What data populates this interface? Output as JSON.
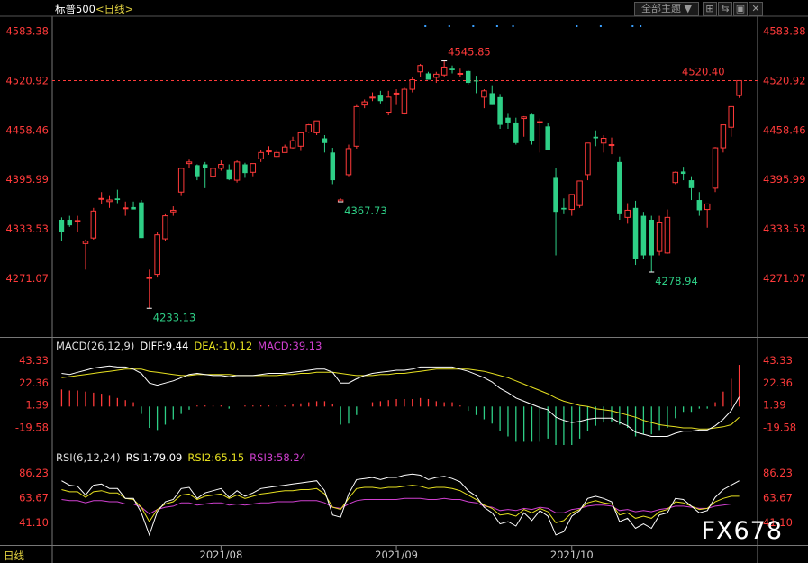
{
  "header": {
    "symbol": "标普500",
    "period_prefix": "<",
    "period": "日线",
    "period_suffix": ">",
    "theme_menu": "全部主题",
    "theme_arrow": "▼"
  },
  "toolbar": {
    "icons": [
      "crosshair-icon",
      "restore-icon",
      "dock-icon",
      "close-icon"
    ],
    "glyphs": [
      "⊞",
      "⇆",
      "▣",
      "✕"
    ]
  },
  "watermark": "FX678",
  "bottom_label": "日线",
  "colors": {
    "up": "#ff3a3a",
    "down": "#2ecf86",
    "axis_text": "#ff3a3a",
    "grid": "#333333",
    "last_line": "#ff3a3a",
    "diff": "#ffffff",
    "dea": "#e6e020",
    "macd": "#d040d0",
    "rsi1": "#ffffff",
    "rsi2": "#e6e020",
    "rsi3": "#d040d0",
    "annot_high": "#ff3a3a",
    "annot_low": "#2ecf86"
  },
  "chart_data": [
    {
      "type": "candlestick",
      "ylim": [
        4230,
        4600
      ],
      "yticks": [
        "4583.38",
        "4520.92",
        "4458.46",
        "4395.99",
        "4333.53",
        "4271.07"
      ],
      "last_price": 4520.92,
      "candles": [
        [
          4345,
          4348,
          4318,
          4330
        ],
        [
          4345,
          4350,
          4336,
          4338
        ],
        [
          4343,
          4350,
          4330,
          4344
        ],
        [
          4315,
          4320,
          4282,
          4318
        ],
        [
          4322,
          4360,
          4320,
          4356
        ],
        [
          4372,
          4380,
          4365,
          4372
        ],
        [
          4368,
          4375,
          4360,
          4370
        ],
        [
          4372,
          4383,
          4366,
          4370
        ],
        [
          4360,
          4368,
          4350,
          4360
        ],
        [
          4361,
          4368,
          4358,
          4358
        ],
        [
          4367,
          4370,
          4322,
          4322
        ],
        [
          4272,
          4282,
          4233.13,
          4272
        ],
        [
          4276,
          4330,
          4272,
          4326
        ],
        [
          4321,
          4352,
          4318,
          4350
        ],
        [
          4355,
          4362,
          4350,
          4357
        ],
        [
          4380,
          4410,
          4375,
          4410
        ],
        [
          4416,
          4421,
          4410,
          4418
        ],
        [
          4414,
          4415,
          4395,
          4400
        ],
        [
          4415,
          4418,
          4385,
          4410
        ],
        [
          4400,
          4410,
          4397,
          4410
        ],
        [
          4410,
          4420,
          4407,
          4415
        ],
        [
          4408,
          4415,
          4395,
          4396
        ],
        [
          4395,
          4420,
          4392,
          4418
        ],
        [
          4415,
          4417,
          4398,
          4404
        ],
        [
          4405,
          4415,
          4400,
          4416
        ],
        [
          4422,
          4433,
          4418,
          4430
        ],
        [
          4432,
          4438,
          4427,
          4432
        ],
        [
          4425,
          4433,
          4424,
          4430
        ],
        [
          4430,
          4440,
          4430,
          4437
        ],
        [
          4436,
          4450,
          4435,
          4445
        ],
        [
          4438,
          4455,
          4432,
          4455
        ],
        [
          4456,
          4466,
          4455,
          4465
        ],
        [
          4455,
          4470,
          4452,
          4470
        ],
        [
          4448,
          4452,
          4430,
          4442
        ],
        [
          4430,
          4436,
          4390,
          4395
        ],
        [
          4367.73,
          4372,
          4367.73,
          4370
        ],
        [
          4402,
          4440,
          4400,
          4435
        ],
        [
          4438,
          4490,
          4435,
          4488
        ],
        [
          4490,
          4497,
          4486,
          4494
        ],
        [
          4500,
          4506,
          4495,
          4500
        ],
        [
          4502,
          4508,
          4492,
          4495
        ],
        [
          4481,
          4508,
          4477,
          4500
        ],
        [
          4504,
          4510,
          4490,
          4505
        ],
        [
          4480,
          4512,
          4478,
          4510
        ],
        [
          4510,
          4525,
          4506,
          4522
        ],
        [
          4532,
          4542,
          4525,
          4540
        ],
        [
          4530,
          4532,
          4523,
          4522
        ],
        [
          4525,
          4532,
          4518,
          4529
        ],
        [
          4528,
          4545.85,
          4525,
          4538
        ],
        [
          4536,
          4540,
          4530,
          4534
        ],
        [
          4530,
          4536,
          4525,
          4530
        ],
        [
          4533,
          4534,
          4516,
          4518
        ],
        [
          4521,
          4527,
          4505,
          4520
        ],
        [
          4500,
          4510,
          4486,
          4508
        ],
        [
          4505,
          4515,
          4490,
          4490
        ],
        [
          4500,
          4504,
          4460,
          4465
        ],
        [
          4474,
          4480,
          4460,
          4468
        ],
        [
          4468,
          4474,
          4440,
          4442
        ],
        [
          4473,
          4476,
          4450,
          4475
        ],
        [
          4478,
          4480,
          4440,
          4445
        ],
        [
          4468,
          4473,
          4430,
          4469
        ],
        [
          4463,
          4467,
          4433,
          4433
        ],
        [
          4398,
          4410,
          4300,
          4355
        ],
        [
          4360,
          4372,
          4352,
          4358
        ],
        [
          4358,
          4375,
          4350,
          4377
        ],
        [
          4363,
          4393,
          4360,
          4394
        ],
        [
          4402,
          4442,
          4395,
          4442
        ],
        [
          4450,
          4458,
          4438,
          4448
        ],
        [
          4442,
          4452,
          4430,
          4448
        ],
        [
          4440,
          4449,
          4428,
          4440
        ],
        [
          4418,
          4425,
          4345,
          4352
        ],
        [
          4348,
          4366,
          4340,
          4357
        ],
        [
          4360,
          4369,
          4288,
          4296
        ],
        [
          4350,
          4355,
          4295,
          4300
        ],
        [
          4345,
          4350,
          4278.94,
          4300
        ],
        [
          4305,
          4350,
          4300,
          4341
        ],
        [
          4303,
          4358,
          4302,
          4348
        ],
        [
          4392,
          4406,
          4390,
          4405
        ],
        [
          4406,
          4412,
          4395,
          4403
        ],
        [
          4395,
          4400,
          4370,
          4385
        ],
        [
          4370,
          4380,
          4350,
          4357
        ],
        [
          4358,
          4364,
          4335,
          4365
        ],
        [
          4385,
          4437,
          4380,
          4436
        ],
        [
          4436,
          4460,
          4430,
          4465
        ],
        [
          4462,
          4480,
          4450,
          4488
        ],
        [
          4502,
          4520.92,
          4499,
          4520.92
        ]
      ],
      "annotations": [
        {
          "label": "4545.85",
          "kind": "high"
        },
        {
          "label": "4520.40",
          "kind": "high"
        },
        {
          "label": "4367.73",
          "kind": "low"
        },
        {
          "label": "4233.13",
          "kind": "low"
        },
        {
          "label": "4278.94",
          "kind": "low"
        }
      ],
      "xlabels": [
        "2021/08",
        "2021/09",
        "2021/10"
      ]
    },
    {
      "type": "macd",
      "legend": {
        "name": "MACD(26,12,9)",
        "diff": "DIFF:9.44",
        "dea": "DEA:-10.12",
        "macd": "MACD:39.13"
      },
      "ylim": [
        -36,
        50
      ],
      "yticks": [
        "43.33",
        "22.36",
        "1.39",
        "-19.58"
      ],
      "diff": [
        31,
        30,
        32,
        34,
        36,
        37,
        38,
        37,
        37,
        35,
        31,
        22,
        20,
        22,
        24,
        27,
        30,
        31,
        30,
        29,
        29,
        28,
        29,
        29,
        29,
        30,
        31,
        31,
        31,
        32,
        33,
        34,
        35,
        35,
        32,
        22,
        22,
        26,
        29,
        31,
        32,
        33,
        34,
        34,
        35,
        37,
        37,
        37,
        37,
        37,
        35,
        33,
        30,
        27,
        23,
        17,
        13,
        8,
        5,
        2,
        -1,
        -3,
        -10,
        -13,
        -15,
        -14,
        -12,
        -11,
        -11,
        -11,
        -15,
        -18,
        -24,
        -26,
        -28,
        -28,
        -28,
        -25,
        -23,
        -23,
        -22,
        -22,
        -18,
        -12,
        -4,
        9
      ],
      "dea": [
        27,
        28,
        29,
        30,
        31,
        32,
        33,
        34,
        35,
        35,
        35,
        33,
        32,
        31,
        30,
        29,
        29,
        30,
        30,
        30,
        30,
        30,
        29,
        29,
        29,
        29,
        29,
        29,
        30,
        30,
        31,
        31,
        32,
        32,
        32,
        31,
        30,
        29,
        29,
        29,
        30,
        30,
        31,
        31,
        32,
        33,
        34,
        35,
        35,
        35,
        35,
        35,
        34,
        33,
        31,
        29,
        27,
        24,
        21,
        18,
        15,
        12,
        8,
        5,
        3,
        1,
        0,
        -2,
        -3,
        -4,
        -6,
        -8,
        -10,
        -13,
        -15,
        -17,
        -18,
        -19,
        -20,
        -20,
        -21,
        -21,
        -20,
        -19,
        -17,
        -10
      ],
      "hist": [
        16,
        15,
        15,
        14,
        13,
        12,
        10,
        8,
        6,
        4,
        -7,
        -20,
        -22,
        -17,
        -12,
        -7,
        -3,
        1,
        1,
        1,
        1,
        -2,
        0,
        1,
        1,
        1,
        1,
        1,
        1,
        2,
        3,
        4,
        5,
        5,
        2,
        -17,
        -16,
        -8,
        0,
        4,
        5,
        6,
        7,
        7,
        7,
        8,
        7,
        5,
        4,
        4,
        1,
        -4,
        -8,
        -12,
        -16,
        -23,
        -28,
        -33,
        -33,
        -33,
        -33,
        -30,
        -36,
        -36,
        -36,
        -30,
        -23,
        -18,
        -15,
        -14,
        -17,
        -20,
        -28,
        -26,
        -26,
        -22,
        -20,
        -11,
        -5,
        -5,
        -2,
        -2,
        4,
        14,
        26,
        39
      ]
    },
    {
      "type": "rsi",
      "legend": {
        "name": "RSI(6,12,24)",
        "rsi1": "RSI1:79.09",
        "rsi2": "RSI2:65.15",
        "rsi3": "RSI3:58.24"
      },
      "ylim": [
        25,
        95
      ],
      "yticks": [
        "86.23",
        "63.67",
        "41.10"
      ],
      "rsi1": [
        79,
        75,
        74,
        66,
        75,
        76,
        72,
        72,
        63,
        63,
        50,
        30,
        51,
        60,
        62,
        72,
        73,
        63,
        68,
        70,
        72,
        64,
        70,
        65,
        68,
        72,
        73,
        74,
        75,
        76,
        77,
        78,
        79,
        70,
        48,
        46,
        67,
        80,
        81,
        82,
        80,
        82,
        82,
        84,
        85,
        84,
        80,
        82,
        83,
        81,
        78,
        70,
        65,
        55,
        50,
        40,
        42,
        38,
        50,
        43,
        52,
        47,
        30,
        33,
        47,
        52,
        63,
        65,
        63,
        60,
        42,
        45,
        36,
        40,
        36,
        48,
        50,
        63,
        62,
        56,
        50,
        52,
        64,
        71,
        75,
        79
      ],
      "rsi2": [
        71,
        69,
        69,
        64,
        69,
        70,
        68,
        68,
        63,
        62,
        55,
        42,
        53,
        58,
        60,
        66,
        67,
        62,
        65,
        66,
        67,
        63,
        66,
        63,
        65,
        67,
        68,
        69,
        70,
        70,
        71,
        71,
        72,
        67,
        55,
        53,
        63,
        72,
        73,
        73,
        72,
        73,
        73,
        74,
        75,
        74,
        72,
        73,
        73,
        72,
        70,
        66,
        62,
        57,
        54,
        48,
        49,
        47,
        53,
        50,
        54,
        51,
        41,
        43,
        50,
        53,
        59,
        61,
        59,
        58,
        48,
        50,
        45,
        47,
        45,
        51,
        53,
        60,
        59,
        56,
        53,
        54,
        60,
        63,
        65,
        65
      ],
      "rsi3": [
        62,
        61,
        61,
        59,
        61,
        61,
        60,
        60,
        58,
        58,
        55,
        49,
        53,
        55,
        56,
        59,
        59,
        57,
        58,
        59,
        59,
        57,
        58,
        57,
        58,
        59,
        59,
        60,
        60,
        60,
        61,
        61,
        61,
        59,
        55,
        54,
        58,
        61,
        62,
        62,
        62,
        62,
        62,
        63,
        63,
        63,
        62,
        62,
        63,
        62,
        62,
        60,
        59,
        56,
        55,
        52,
        53,
        52,
        54,
        53,
        55,
        54,
        50,
        50,
        53,
        54,
        56,
        57,
        57,
        56,
        52,
        53,
        51,
        52,
        51,
        53,
        54,
        56,
        56,
        55,
        54,
        54,
        56,
        57,
        58,
        58
      ]
    }
  ]
}
